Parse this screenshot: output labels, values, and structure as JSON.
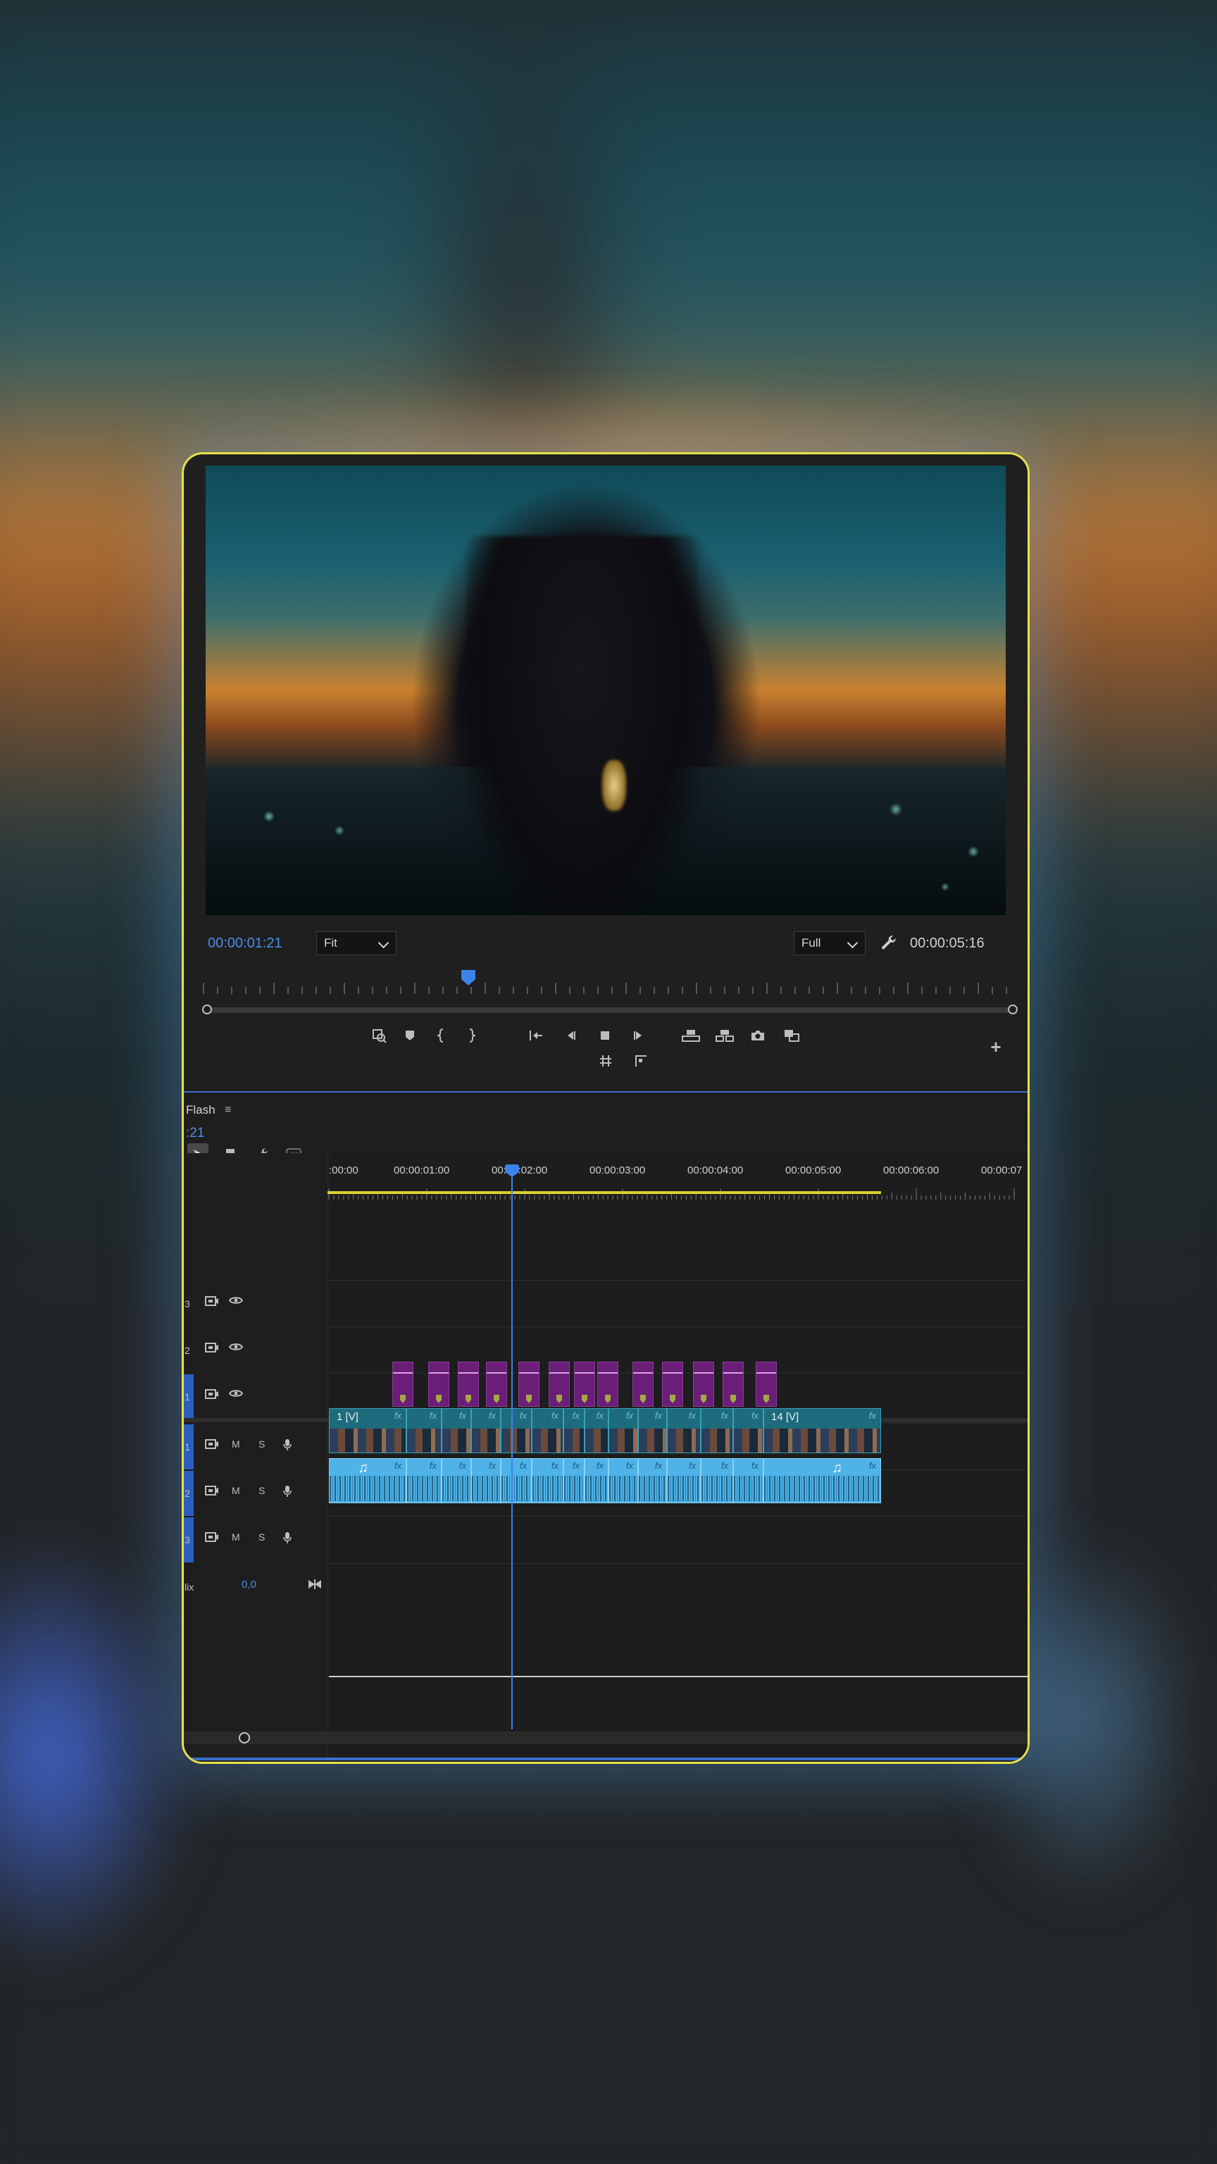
{
  "program_monitor": {
    "current_timecode": "00:00:01:21",
    "zoom_select": "Fit",
    "resolution_select": "Full",
    "duration_timecode": "00:00:05:16"
  },
  "timeline": {
    "panel_title": "Flash",
    "timecode_partial": ":21",
    "ruler_labels": [
      ":00:00",
      "00:00:01:00",
      "00:00:02:00",
      "00:00:03:00",
      "00:00:04:00",
      "00:00:05:00",
      "00:00:06:00",
      "00:00:07"
    ],
    "tracks": {
      "v3": {
        "label": "3"
      },
      "v2": {
        "label": "2"
      },
      "v1": {
        "label": "1"
      },
      "a1": {
        "label": "1",
        "mute": "M",
        "solo": "S"
      },
      "a2": {
        "label": "2",
        "mute": "M",
        "solo": "S"
      },
      "a3": {
        "label": "3",
        "mute": "M",
        "solo": "S"
      },
      "mix": {
        "label": "lix",
        "value": "0,0"
      }
    },
    "clips": {
      "v1_first_label": "1 [V]",
      "v1_last_label": "14 [V]",
      "fx_label": "fx"
    }
  },
  "colors": {
    "frame_border": "#e6e24a",
    "accent_blue": "#4a8ee8",
    "graphics_clip": "#6a1e78",
    "video_clip": "#1d6b7c",
    "audio_clip": "#4fb3e8",
    "work_area": "#d9d32e"
  }
}
